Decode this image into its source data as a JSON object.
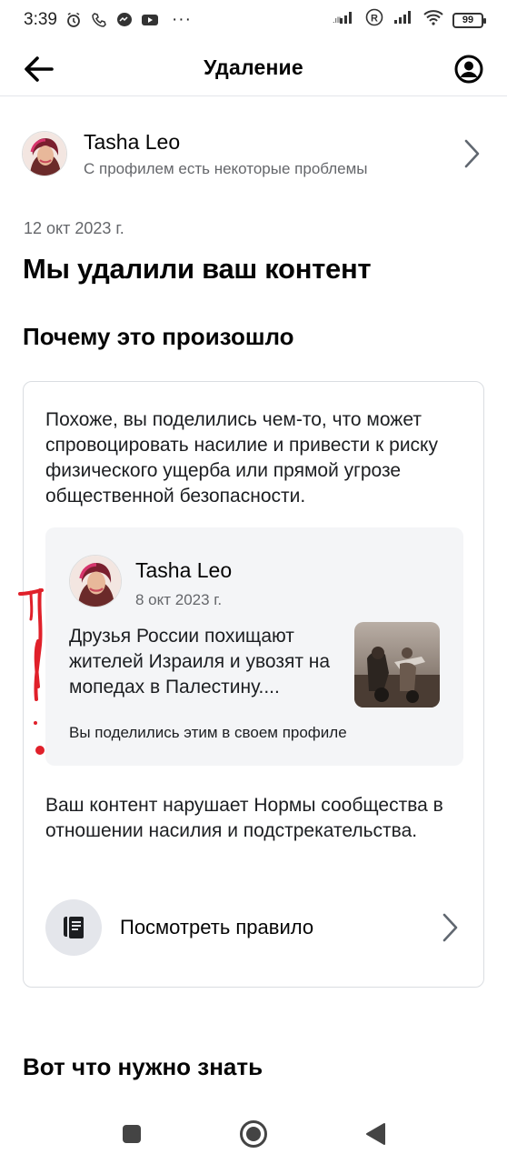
{
  "status_bar": {
    "time": "3:39",
    "more": "···",
    "battery": "99"
  },
  "header": {
    "title": "Удаление"
  },
  "profile": {
    "name": "Tasha  Leo",
    "subtitle": "С профилем есть некоторые проблемы"
  },
  "notice": {
    "date": "12 окт 2023 г.",
    "title": "Мы удалили ваш контент",
    "section_title": "Почему это произошло"
  },
  "card": {
    "explanation": "Похоже, вы поделились чем-то, что может спровоцировать насилие и привести к риску физического ущерба или прямой угрозе общественной безопасности.",
    "post": {
      "author": "Tasha  Leo",
      "date": "8 окт 2023 г.",
      "text": "Друзья России похищают жителей Израиля и увозят на мопедах в Палестину....",
      "shared_note": "Вы поделились этим в своем профиле"
    },
    "violation": "Ваш контент нарушает Нормы сообщества в отношении насилия и подстрекательства.",
    "rule_link": "Посмотреть правило"
  },
  "bottom_section_title": "Вот что нужно знать",
  "colors": {
    "text_primary": "#050505",
    "text_secondary": "#65676b",
    "card_border": "#dadde1",
    "post_bg": "#f4f5f7",
    "annotation_red": "#e0202a"
  },
  "icons": {
    "back": "arrow-left-icon",
    "account": "account-circle-icon",
    "chevron": "chevron-right-icon",
    "rule": "rulebook-icon",
    "nav_recents": "square-icon",
    "nav_home": "circle-icon",
    "nav_back": "triangle-back-icon"
  }
}
